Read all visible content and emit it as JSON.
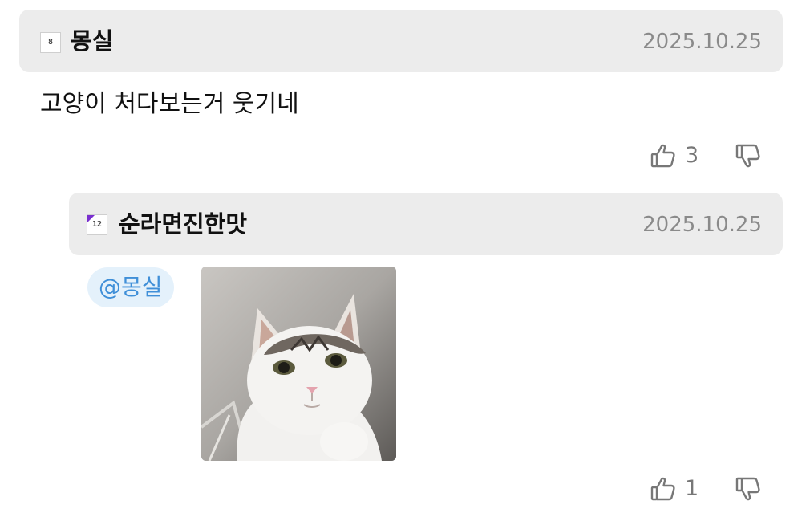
{
  "comments": [
    {
      "author": "몽실",
      "level_badge": "8",
      "date": "2025.10.25",
      "text": "고양이 처다보는거 웃기네",
      "likes": "3"
    },
    {
      "author": "순라면진한맛",
      "level_badge": "12",
      "date": "2025.10.25",
      "mention": "@몽실",
      "image": "cat-photo",
      "likes": "1"
    }
  ],
  "icons": {
    "like": "thumbs-up-icon",
    "dislike": "thumbs-down-icon"
  },
  "colors": {
    "header_bg": "#ececec",
    "mention_bg": "#e4f1fb",
    "mention_text": "#3f8fd8",
    "muted_text": "#8a8a8a",
    "level_badge_accent": "#7a2fd0"
  }
}
